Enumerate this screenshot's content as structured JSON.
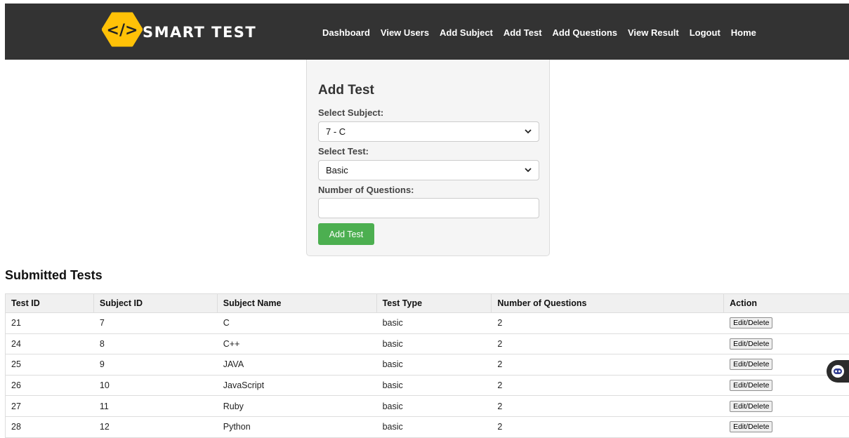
{
  "brand": {
    "name": "SMART TEST",
    "logo_glyph": "</>",
    "accent": "#ffc107"
  },
  "nav": [
    "Dashboard",
    "View Users",
    "Add Subject",
    "Add Test",
    "Add Questions",
    "View Result",
    "Logout",
    "Home"
  ],
  "form": {
    "title": "Add Test",
    "subject_label": "Select Subject:",
    "subject_value": "7 - C",
    "test_label": "Select Test:",
    "test_value": "Basic",
    "questions_label": "Number of Questions:",
    "questions_value": "",
    "submit_label": "Add Test"
  },
  "submitted": {
    "title": "Submitted Tests",
    "columns": [
      "Test ID",
      "Subject ID",
      "Subject Name",
      "Test Type",
      "Number of Questions",
      "Action"
    ],
    "rows": [
      [
        "21",
        "7",
        "C",
        "basic",
        "2",
        "Edit/Delete"
      ],
      [
        "24",
        "8",
        "C++",
        "basic",
        "2",
        "Edit/Delete"
      ],
      [
        "25",
        "9",
        "JAVA",
        "basic",
        "2",
        "Edit/Delete"
      ],
      [
        "26",
        "10",
        "JavaScript",
        "basic",
        "2",
        "Edit/Delete"
      ],
      [
        "27",
        "11",
        "Ruby",
        "basic",
        "2",
        "Edit/Delete"
      ],
      [
        "28",
        "12",
        "Python",
        "basic",
        "2",
        "Edit/Delete"
      ]
    ]
  },
  "colors": {
    "header_bg": "#333333",
    "button_green": "#4caf50"
  }
}
